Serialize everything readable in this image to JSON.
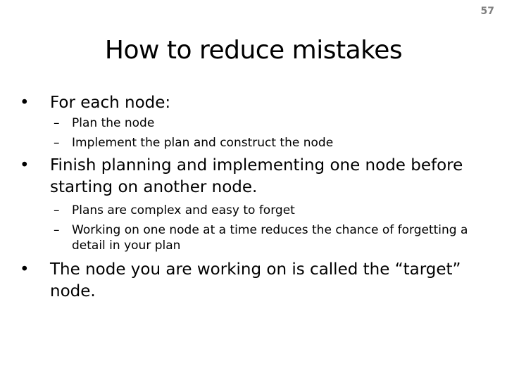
{
  "slide_number": "57",
  "title": "How to reduce mistakes",
  "bullets": [
    {
      "text": "For each node:",
      "subitems": [
        "Plan the node",
        "Implement the plan and construct the node"
      ]
    },
    {
      "text": "Finish planning and implementing one node before starting on another node.",
      "subitems": [
        "Plans are complex and easy to forget",
        "Working on one node at a time reduces the chance of forgetting a detail in your plan"
      ]
    },
    {
      "text": "The node you are working on is called the “target” node.",
      "subitems": []
    }
  ],
  "markers": {
    "bullet": "•",
    "sub": "–"
  }
}
